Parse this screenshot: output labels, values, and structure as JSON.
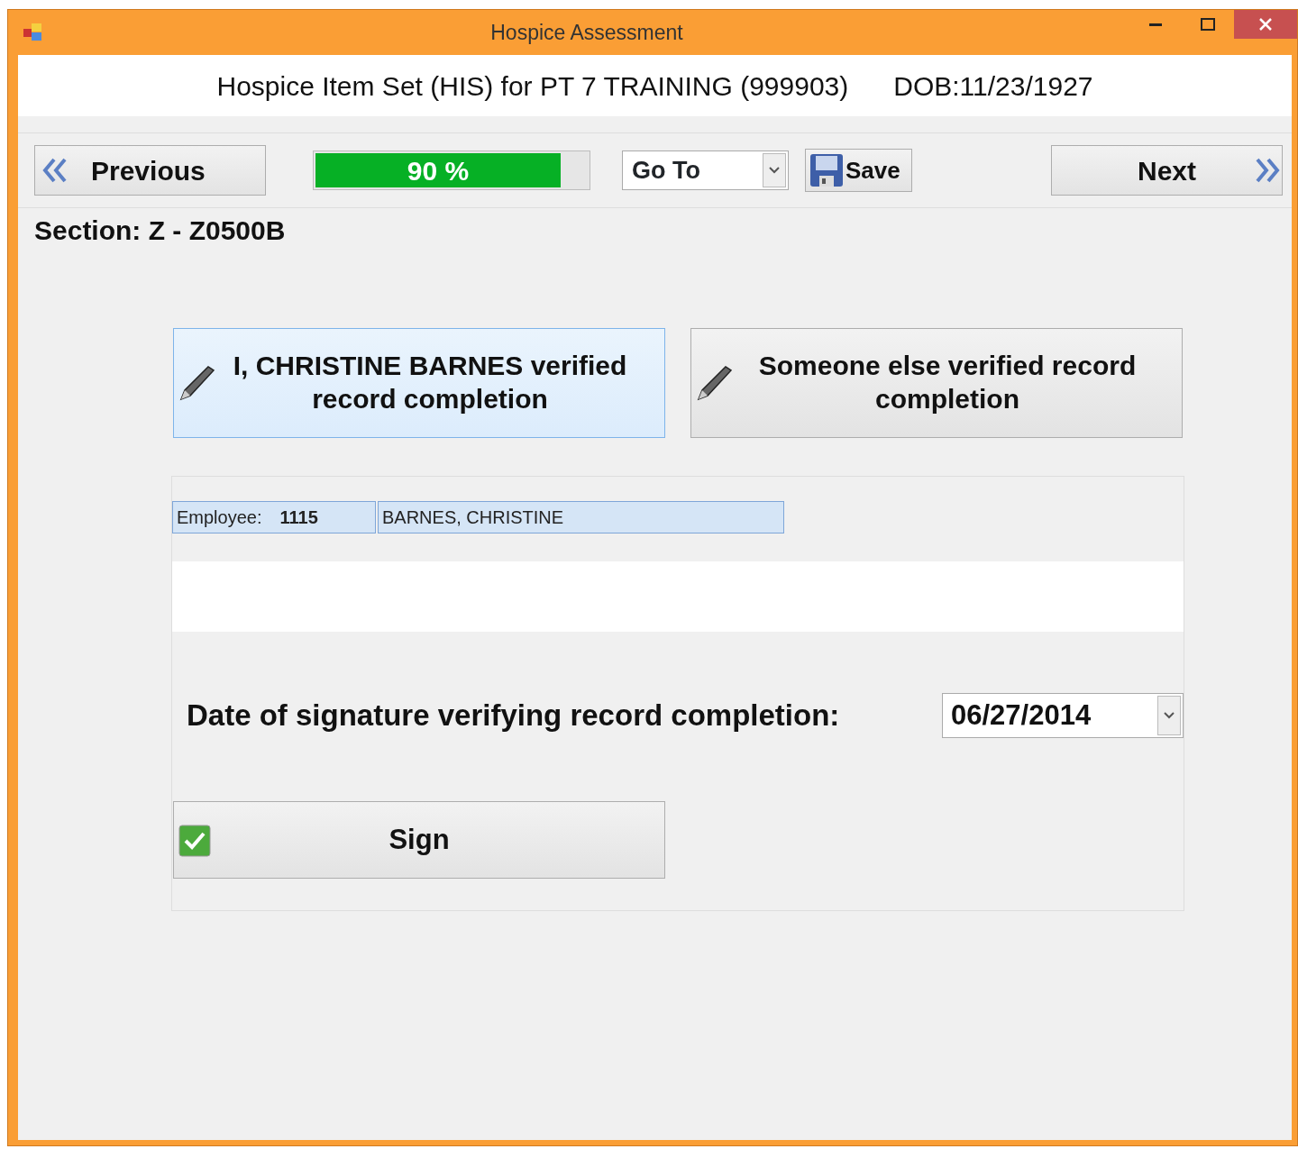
{
  "window": {
    "title": "Hospice Assessment"
  },
  "header": {
    "title": "Hospice Item Set (HIS) for PT 7 TRAINING  (999903)",
    "dob": "DOB:11/23/1927"
  },
  "toolbar": {
    "previous": "Previous",
    "progress": {
      "label": "90 %",
      "level": 0.9
    },
    "goto": "Go To",
    "save": "Save",
    "next": "Next"
  },
  "section": "Section: Z - Z0500B",
  "verification_options": [
    {
      "label": "I, CHRISTINE BARNES verified record completion",
      "selected": true
    },
    {
      "label": "Someone else verified record completion",
      "selected": false
    }
  ],
  "employee": {
    "label": "Employee:",
    "id": "1115",
    "name": "BARNES, CHRISTINE"
  },
  "date": {
    "label": "Date of signature verifying record completion:",
    "value": "06/27/2014"
  },
  "sign": {
    "label": "Sign",
    "checked": true
  }
}
